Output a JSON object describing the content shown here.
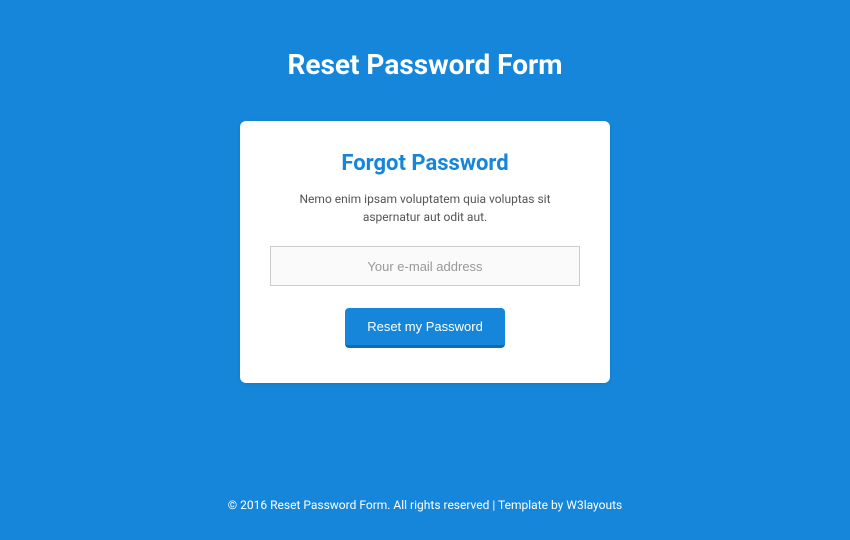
{
  "page": {
    "title": "Reset Password Form"
  },
  "card": {
    "title": "Forgot Password",
    "description": "Nemo enim ipsam voluptatem quia voluptas sit aspernatur aut odit aut.",
    "email_placeholder": "Your e-mail address",
    "email_value": "",
    "button_label": "Reset my Password"
  },
  "footer": {
    "copyright": "© 2016 Reset Password Form. All rights reserved | Template by ",
    "link_text": "W3layouts"
  }
}
